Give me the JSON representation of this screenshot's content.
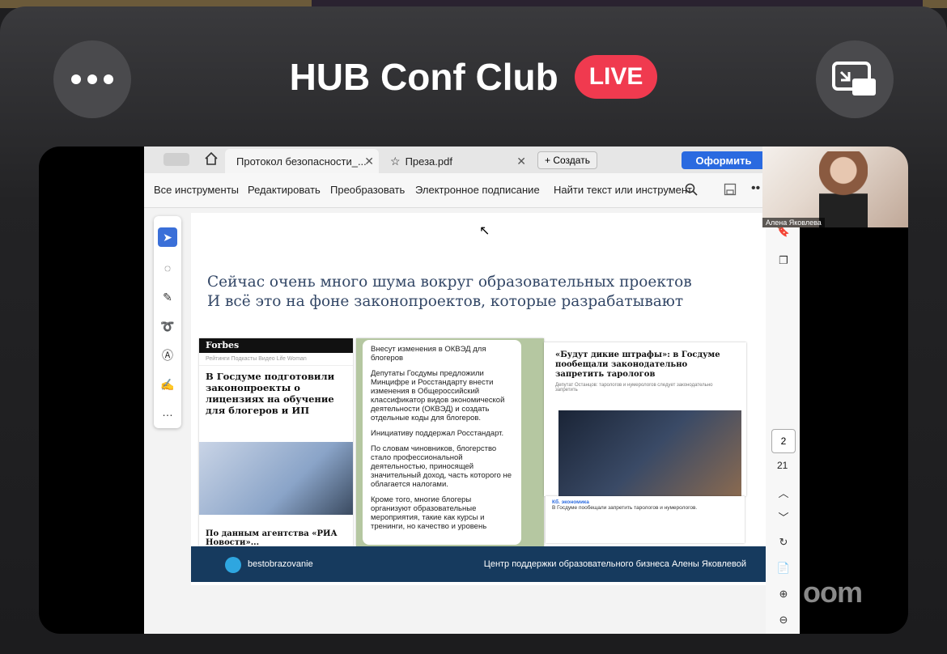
{
  "header": {
    "title": "HUB Conf Club",
    "live_badge": "LIVE"
  },
  "browser": {
    "tabs": [
      {
        "label": "Протокол безопасности_...",
        "close": "✕"
      },
      {
        "label": "Преза.pdf",
        "close": "✕"
      }
    ],
    "create_label": "+ Создать",
    "primary_button": "Оформить"
  },
  "toolbar": {
    "items": [
      "Все инструменты",
      "Редактировать",
      "Преобразовать",
      "Электронное подписание"
    ],
    "search_label": "Найти текст или инструмент"
  },
  "slide": {
    "title_line1": "Сейчас очень много шума вокруг образовательных проектов",
    "title_line2": "И всё это на фоне законопроектов, которые разрабатывают",
    "forbes": {
      "brand": "Forbes",
      "nav": "Рейтинги  Подкасты  Видео  Life  Woman",
      "headline": "В Госдуме подготовили законопроекты о лицензиях на обучение для блогеров и ИП",
      "bottom": "По данным агентства «РИА Новости»..."
    },
    "telegram_post": {
      "p1": "Внесут изменения в ОКВЭД для блогеров",
      "p2": "Депутаты Госдумы предложили Минцифре и Росстандарту внести изменения в Общероссийский классификатор видов экономической деятельности (ОКВЭД) и создать отдельные коды для блогеров.",
      "p3": "Инициативу поддержал Росстандарт.",
      "p4": "По словам чиновников, блогерство стало профессиональной деятельностью, приносящей значительный доход, часть которого не облагается налогами.",
      "p5": "Кроме того, многие блогеры организуют образовательные мероприятия, такие как курсы и тренинги, но качество и уровень"
    },
    "news": {
      "headline": "«Будут дикие штрафы»: в Госдуме пообещали законодательно запретить тарологов",
      "sub": "Депутат Останцов: тарологов и нумерологов следует законодательно запретить",
      "source": "Кб. экономика",
      "text": "В Госдуме пообещали запретить тарологов и нумерологов."
    },
    "footer": {
      "telegram_handle": "bestobrazovanie",
      "center_name": "Центр поддержки образовательного бизнеса Алены Яковлевой"
    }
  },
  "pager": {
    "current_page": "2",
    "total_pages": "21"
  },
  "video_tile": {
    "name": "Алена Яковлева"
  },
  "watermark": "oom"
}
